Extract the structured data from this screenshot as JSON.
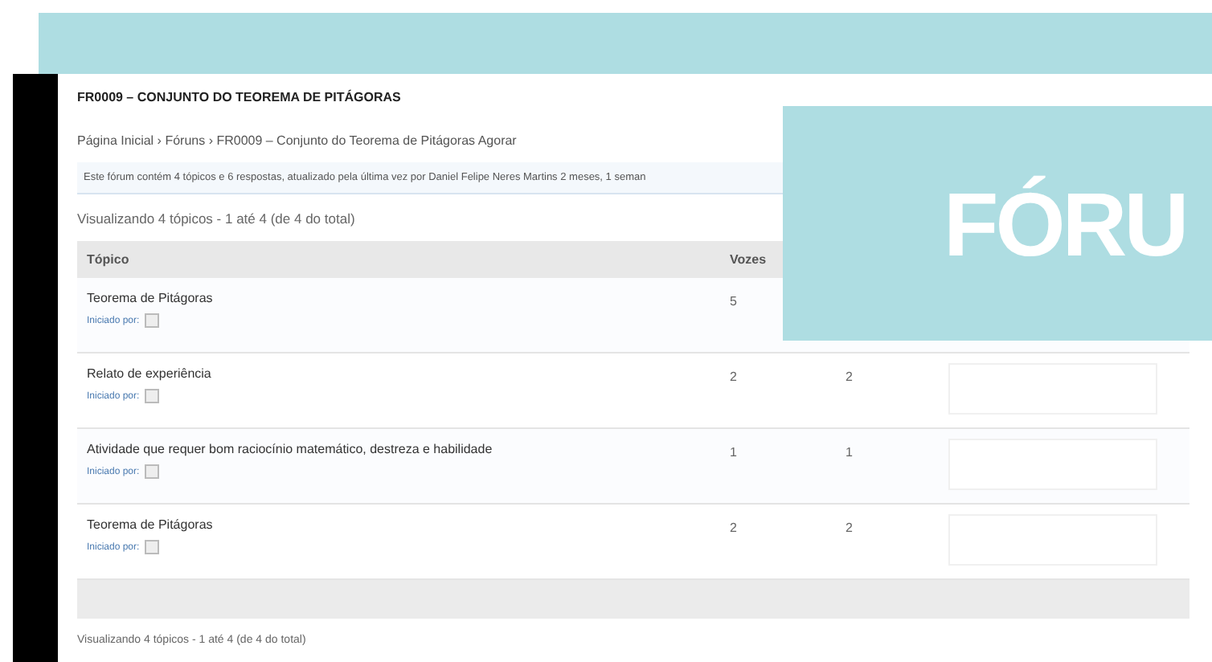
{
  "page_title": "FR0009 – CONJUNTO DO TEOREMA DE PITÁGORAS",
  "breadcrumb": "Página Inicial › Fóruns › FR0009 – Conjunto do Teorema de Pitágoras Agorar",
  "info_notice": "Este fórum contém 4 tópicos e 6 respostas, atualizado pela última vez por Daniel Felipe Neres Martins 2 meses, 1 seman",
  "pagination_top": "Visualizando 4 tópicos - 1 até 4 (de 4 do total)",
  "table": {
    "columns": [
      "Tópico",
      "Vozes"
    ],
    "rows": [
      {
        "topic": "Teorema de Pitágoras",
        "started_by": "Iniciado por:",
        "voices": "5"
      },
      {
        "topic": "Relato de experiência",
        "started_by": "Iniciado por:",
        "voices": "2",
        "posts": "2"
      },
      {
        "topic": "Atividade que requer bom raciocínio matemático, destreza e habilidade",
        "started_by": "Iniciado por:",
        "voices": "1",
        "posts": "1"
      },
      {
        "topic": "Teorema de Pitágoras",
        "started_by": "Iniciado por:",
        "voices": "2",
        "posts": "2"
      }
    ]
  },
  "pagination_bottom": "Visualizando 4 tópicos - 1 até 4 (de 4 do total)",
  "banner": "FÓRU"
}
